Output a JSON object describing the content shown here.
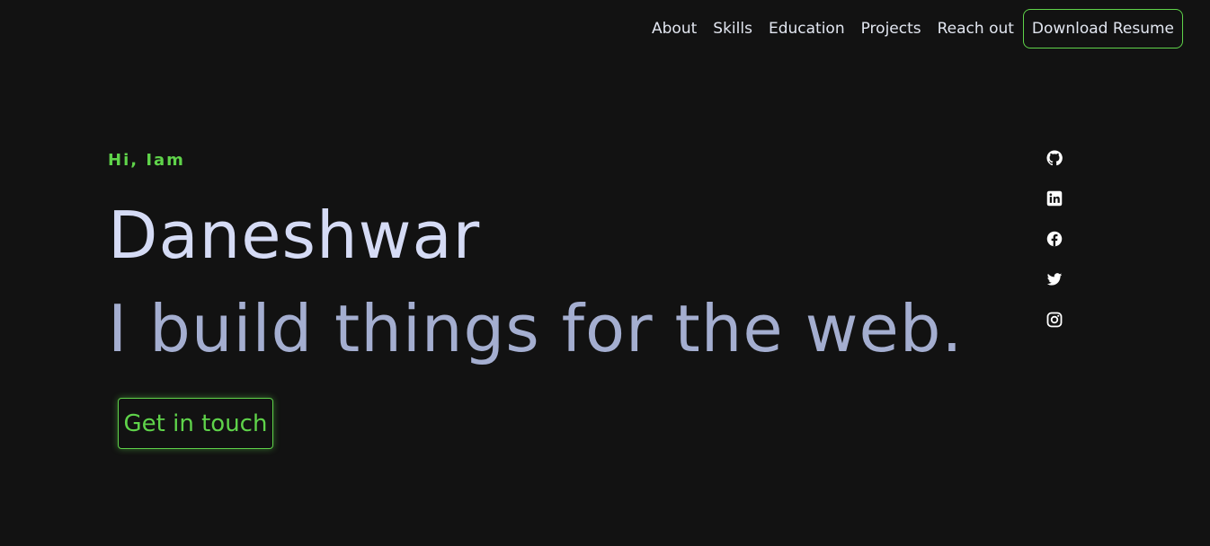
{
  "nav": {
    "links": [
      "About",
      "Skills",
      "Education",
      "Projects",
      "Reach out"
    ],
    "resume_label": "Download Resume"
  },
  "hero": {
    "greeting": "Hi, Iam",
    "name": "Daneshwar",
    "tagline": "I build things for the web.",
    "cta_label": "Get in touch"
  },
  "social": {
    "icons": [
      "github-icon",
      "linkedin-icon",
      "facebook-icon",
      "twitter-icon",
      "instagram-icon"
    ]
  },
  "colors": {
    "background": "#121212",
    "accent": "#5fd34a",
    "name_text": "#d5dbf5",
    "tagline_text": "#a4aed0",
    "nav_text": "#e2e6f0"
  }
}
